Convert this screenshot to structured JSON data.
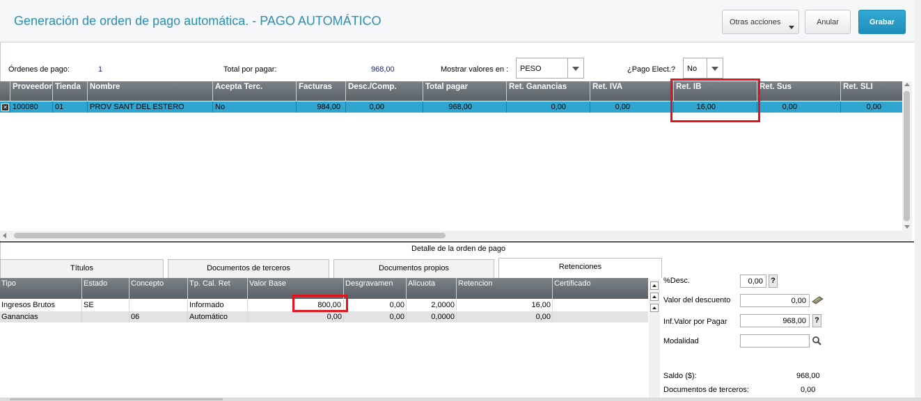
{
  "header": {
    "title": "Generación de orden de pago automática. - PAGO AUTOMÁTICO",
    "buttons": {
      "otras": "Otras acciones",
      "anular": "Anular",
      "grabar": "Grabar"
    }
  },
  "filters": {
    "ordenes_label": "Órdenes de pago:",
    "ordenes_value": "1",
    "total_label": "Total por pagar:",
    "total_value": "968,00",
    "mostrar_label": "Mostrar valores en :",
    "mostrar_value": "PESO",
    "pago_elect_label": "¿Pago Elect.?",
    "pago_elect_value": "No"
  },
  "orders_grid": {
    "headers": [
      "Proveedor",
      "Tienda",
      "Nombre",
      "Acepta Terc.",
      "Facturas",
      "Desc./Comp.",
      "Total pagar",
      "Ret. Ganancias",
      "Ret. IVA",
      "Ret. IB",
      "Ret. Sus",
      "Ret. SLI"
    ],
    "rows": [
      {
        "check": "✕",
        "cells": [
          "100080",
          "01",
          "PROV SANT DEL ESTERO",
          "No",
          "984,00",
          "0,00",
          "968,00",
          "0,00",
          "0,00",
          "16,00",
          "0,00",
          "0,00"
        ]
      }
    ]
  },
  "detail": {
    "title": "Detalle de la orden de pago",
    "tabs": [
      "Títulos",
      "Documentos de terceros",
      "Documentos propios",
      "Retenciones"
    ],
    "active_tab": "Retenciones"
  },
  "retenciones_grid": {
    "headers": [
      "Tipo",
      "Estado",
      "Concepto",
      "Tp. Cal. Ret",
      "Valor Base",
      "Desgravamen",
      "Alicuota",
      "Retencion",
      "Certificado"
    ],
    "rows": [
      [
        "Ingresos Brutos",
        "SE",
        "",
        "Informado",
        "800,00",
        "0,00",
        "2,0000",
        "16,00",
        ""
      ],
      [
        "Ganancias",
        "",
        "06",
        "Automático",
        "0,00",
        "0,00",
        "0,0000",
        "0,00",
        ""
      ]
    ]
  },
  "summary": {
    "desc_label": "%Desc.",
    "desc_value": "0,00",
    "valor_desc_label": "Valor del descuento",
    "valor_desc_value": "0,00",
    "inf_valor_label": "Inf.Valor por Pagar",
    "inf_valor_value": "968,00",
    "modalidad_label": "Modalidad",
    "modalidad_value": "",
    "saldo_label": "Saldo ($):",
    "saldo_value": "968,00",
    "docs_terceros_label": "Documentos de terceros:",
    "docs_terceros_value": "0,00",
    "help_glyph": "?"
  },
  "colors": {
    "accent": "#2a8fb4",
    "selected_row": "#2fa5cf",
    "highlight": "#e3141f",
    "header_grid": "#6a7177"
  }
}
